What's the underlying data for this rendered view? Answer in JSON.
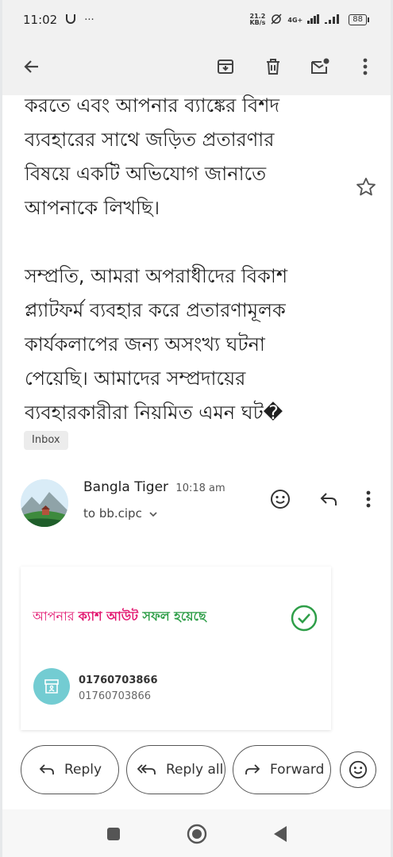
{
  "status_bar": {
    "time": "11:02",
    "speed_value": "21.2",
    "speed_unit": "KB/s",
    "network": "4G+",
    "battery": "88"
  },
  "toolbar": {
    "back_icon": "arrow-back-icon",
    "archive_icon": "archive-icon",
    "delete_icon": "trash-icon",
    "mark_unread_icon": "mail-unread-icon",
    "more_icon": "more-vert-icon"
  },
  "message": {
    "paragraph1": [
      "করতে এবং আপনার ব্যাঙ্কের বিশদ",
      "ব্যবহারের সাথে জড়িত প্রতারণার",
      "বিষয়ে একটি অভিযোগ জানাতে",
      "আপনাকে লিখছি।"
    ],
    "paragraph2": [
      "সম্প্রতি, আমরা অপরাধীদের বিকাশ",
      "প্ল্যাটফর্ম ব্যবহার করে প্রতারণামূলক",
      "কার্যকলাপের জন্য অসংখ্য ঘটনা",
      "পেয়েছি। আমাদের সম্প্রদায়ের",
      "ব্যবহারকারীরা নিয়মিত এমন ঘট�"
    ],
    "label": "Inbox"
  },
  "sender": {
    "name": "Bangla Tiger",
    "time": "10:18 am",
    "to": "to bb.cipc"
  },
  "receipt": {
    "title_part1": "আপনার ",
    "title_part2": "ক্যাশ আউট ",
    "title_part3": "সফল হয়েছে",
    "account_primary": "01760703866",
    "account_secondary": "01760703866",
    "colors": {
      "brand": "#e2136e",
      "success": "#2e9e48",
      "merchant_bg": "#73ccd2"
    }
  },
  "actions": {
    "reply": "Reply",
    "reply_all": "Reply all",
    "forward": "Forward"
  }
}
